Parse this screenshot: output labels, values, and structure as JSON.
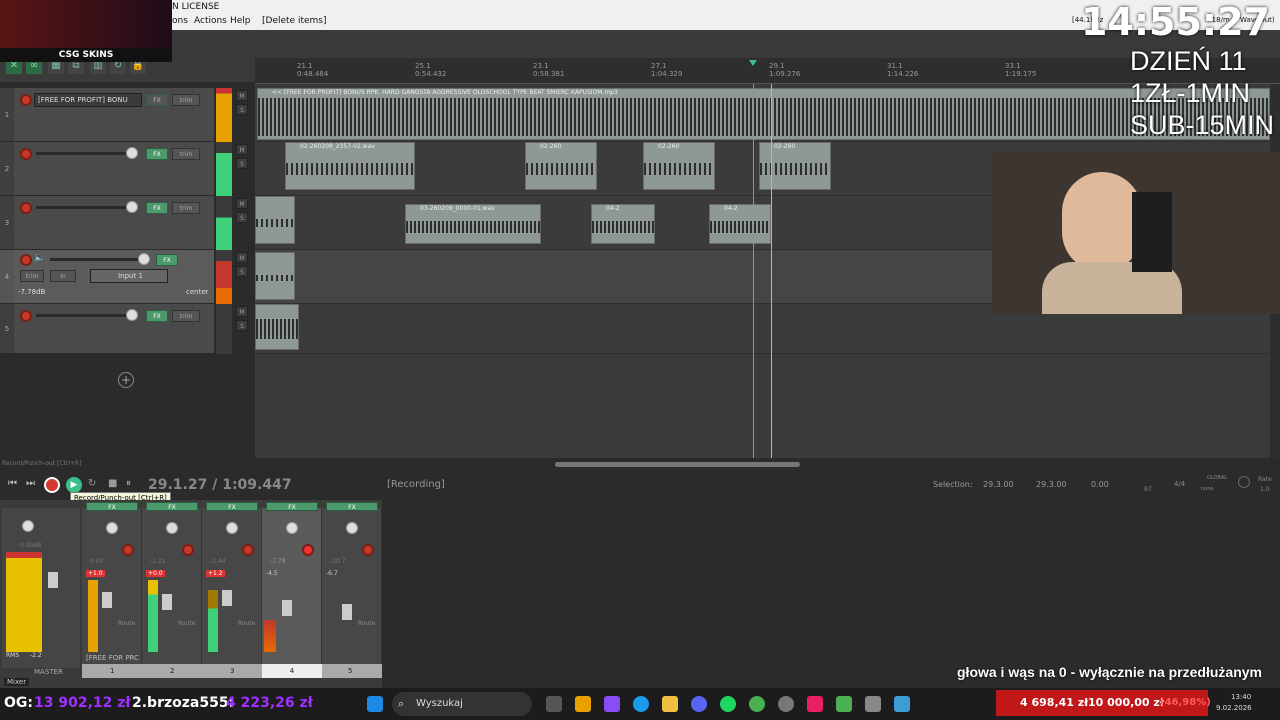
{
  "menu": {
    "items": [
      "ons",
      "Actions",
      "Help",
      "[Delete items]"
    ],
    "title_fragment": "N LICENSE",
    "audio_status": "[44.1kHz",
    "audio_status_suffix": "...18/m",
    "audio_device": "WaveOut)"
  },
  "stream_overlay": {
    "clock": "14:55:27",
    "day": "DZIEŃ 11",
    "rate1": "1ZŁ-1MIN",
    "rate2": "SUB-15MIN",
    "sponsor": "CSG SKINS",
    "banner": "głowa i wąs na 0 - wyłącznie na przedłużanym",
    "ticker_left_label": "OG:",
    "ticker_left_value": "13 902,12 zł",
    "ticker_user": "2.brzoza555:",
    "ticker_user_value": "4 223,26 zł",
    "goal_current": "4 698,41 zł",
    "goal_target": "10 000,00 zł",
    "goal_percent": "(46,98%)"
  },
  "ruler": {
    "marks": [
      {
        "bar": "21.1",
        "time": "0:48.484"
      },
      {
        "bar": "25.1",
        "time": "0:54.432"
      },
      {
        "bar": "23.1",
        "time": "0:58.381"
      },
      {
        "bar": "27.1",
        "time": "1:04.329"
      },
      {
        "bar": "29.1",
        "time": "1:09.276"
      },
      {
        "bar": "31.1",
        "time": "1:14.226"
      },
      {
        "bar": "33.1",
        "time": "1:19.175"
      }
    ]
  },
  "tracks": [
    {
      "num": "1",
      "name": "[FREE FOR PROFIT] BONU",
      "fx": "FX",
      "trim": "trim"
    },
    {
      "num": "2",
      "name": "",
      "fx": "FX",
      "trim": "trim"
    },
    {
      "num": "3",
      "name": "",
      "fx": "FX",
      "trim": "trim"
    },
    {
      "num": "4",
      "name": "",
      "fx": "FX",
      "trim": "trim",
      "input": "Input 1",
      "volume": "-7.78dB",
      "pan": "center",
      "in": "in"
    },
    {
      "num": "5",
      "name": "",
      "fx": "FX",
      "trim": "trim"
    }
  ],
  "items": {
    "t1": "<< [FREE FOR PROFIT] BONUS RPK, HARD GANGSTA AGGRESSIVE OLDSCHOOL TYPE BEAT ŚMIERĆ KAPUSIOM.mp3",
    "t2a": "02-260208_2357-02.wav",
    "t2b": "02-260",
    "t2c": "02-260",
    "t2d": "02-260",
    "t3a": "03-260209_0000-01.wav",
    "t3b": "04-2",
    "t3c": "04-2"
  },
  "transport": {
    "position": "29.1.27 / 1:09.447",
    "status": "[Recording]",
    "tooltip": "Record/Punch-out [Ctrl+R]",
    "hint": "Record/Punch-out [Ctrl+R]",
    "selection_label": "Selection:",
    "sel_start": "29.3.00",
    "sel_end": "29.3.00",
    "sel_len": "0.00",
    "bpm": "97",
    "timesig": "4/4",
    "global": "GLOBAL",
    "none": "none",
    "rate_label": "Rate",
    "rate": "1.0"
  },
  "mixer": {
    "master_label": "MASTER",
    "master_db": "0.00dB",
    "rms": "RMS",
    "rms_val": "-2.2",
    "channel_names": [
      "[FREE FOR PRC",
      "",
      "",
      "",
      ""
    ],
    "channel_nums": [
      "1",
      "2",
      "3",
      "4",
      "5"
    ],
    "channel_db": [
      "0.00",
      "-1.22",
      "-2.44",
      "-7.78",
      "-10.7"
    ],
    "peaks": [
      "+1.0",
      "+0.0",
      "+1.2",
      "-4.5",
      "-6.7"
    ],
    "route": "Route",
    "fx": "FX",
    "mixer_tab": "Mixer"
  },
  "taskbar": {
    "search_placeholder": "Wyszukaj",
    "time": "13:40",
    "date": "9.02.2026"
  }
}
